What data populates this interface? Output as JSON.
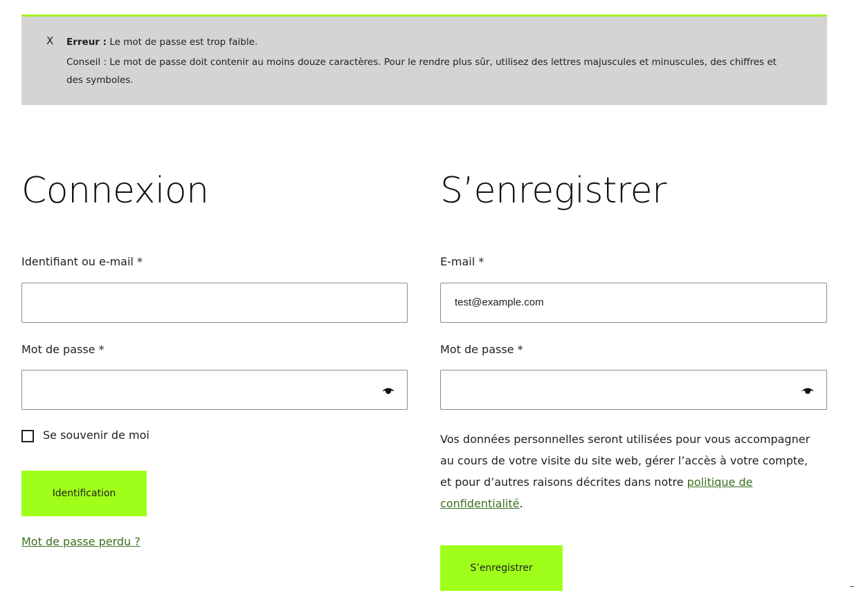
{
  "notice": {
    "close_label": "X",
    "error_label": "Erreur :",
    "error_text": " Le mot de passe est trop faible.",
    "hint_text": "Conseil : Le mot de passe doit contenir au moins douze caractères. Pour le rendre plus sûr, utilisez des lettres majuscules et minuscules, des chiffres et des symboles."
  },
  "login": {
    "title": "Connexion",
    "username_label": "Identifiant ou e-mail *",
    "username_value": "",
    "password_label": "Mot de passe *",
    "password_value": "",
    "remember_label": "Se souvenir de moi",
    "submit_label": "Identification",
    "lost_password_label": "Mot de passe perdu ?"
  },
  "register": {
    "title": "S’enregistrer",
    "email_label": "E-mail *",
    "email_value": "test@example.com",
    "password_label": "Mot de passe *",
    "password_value": "",
    "privacy_before": "Vos données personnelles seront utilisées pour vous accompagner au cours de votre visite du site web, gérer l’accès à votre compte, et pour d’autres raisons décrites dans notre ",
    "privacy_link": "politique de confidentialité",
    "privacy_after": ".",
    "submit_label": "S’enregistrer"
  },
  "icons": {
    "show_password": "eye-icon"
  },
  "colors": {
    "accent": "#a0ff1a",
    "notice_bg": "#d4d4d4",
    "link": "#3a6e1c"
  }
}
